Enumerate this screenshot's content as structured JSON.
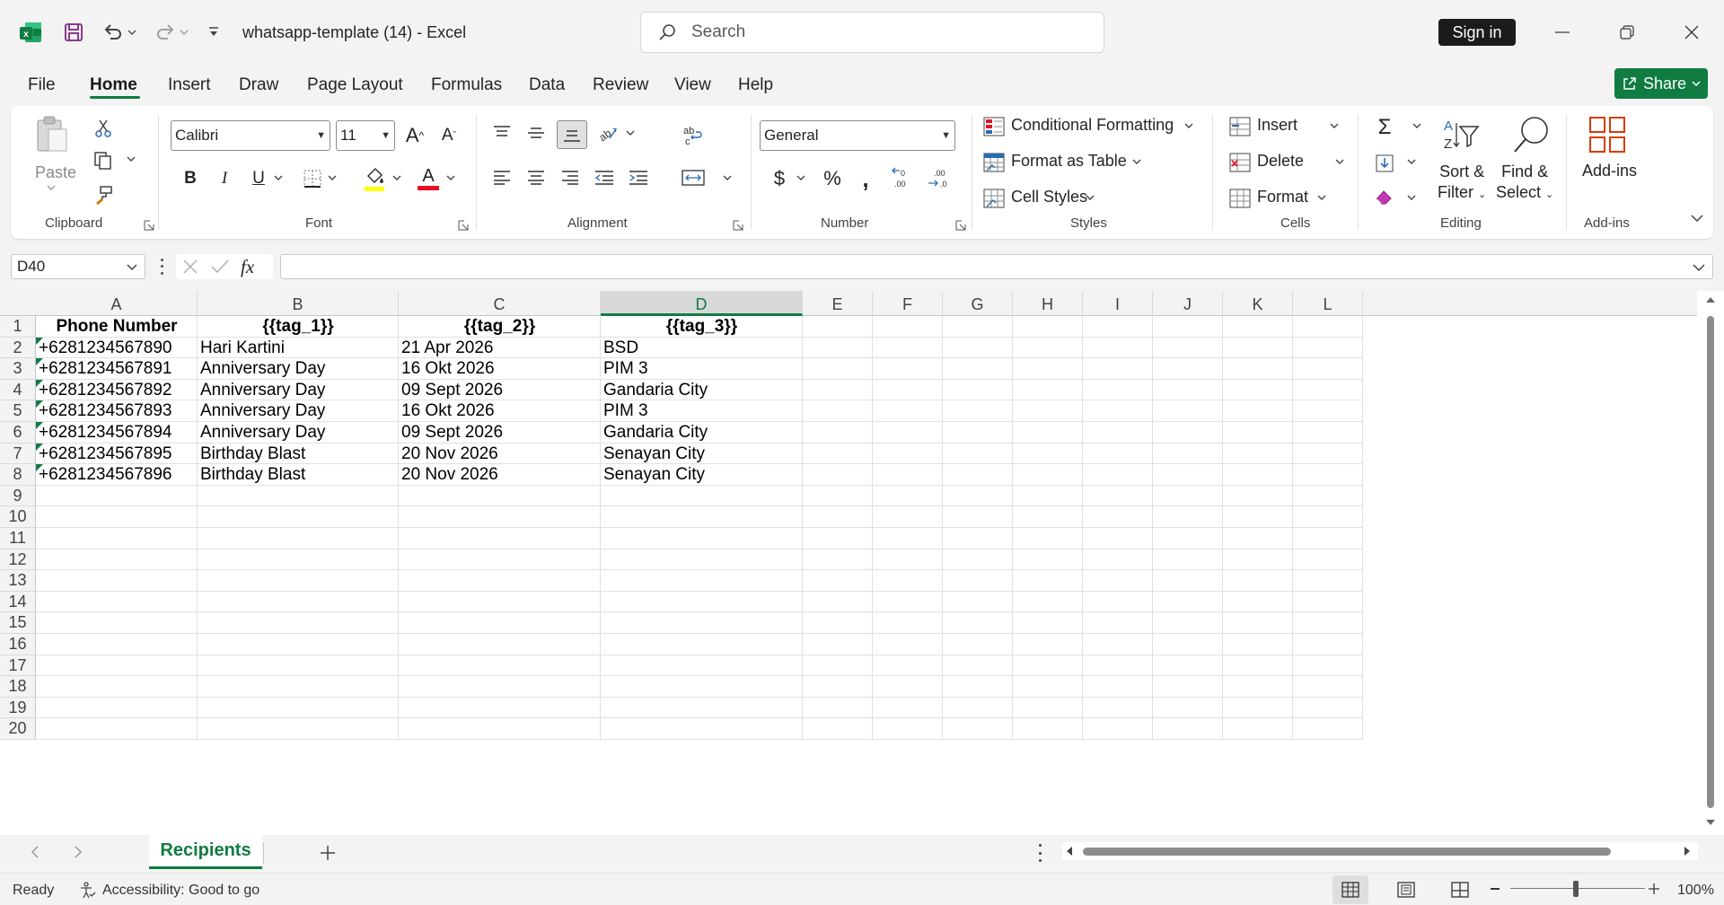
{
  "titlebar": {
    "doc_title": "whatsapp-template (14)  -  Excel",
    "search_placeholder": "Search",
    "signin_label": "Sign in"
  },
  "menu": {
    "tabs": [
      "File",
      "Home",
      "Insert",
      "Draw",
      "Page Layout",
      "Formulas",
      "Data",
      "Review",
      "View",
      "Help"
    ],
    "active": "Home",
    "share_label": "Share"
  },
  "ribbon": {
    "clipboard": {
      "label": "Clipboard",
      "paste": "Paste"
    },
    "font": {
      "label": "Font",
      "name": "Calibri",
      "size": "11"
    },
    "alignment": {
      "label": "Alignment"
    },
    "number": {
      "label": "Number",
      "format": "General"
    },
    "styles": {
      "label": "Styles",
      "conditional": "Conditional Formatting",
      "format_table": "Format as Table",
      "cell_styles": "Cell Styles"
    },
    "cells": {
      "label": "Cells",
      "insert": "Insert",
      "delete": "Delete",
      "format": "Format"
    },
    "editing": {
      "label": "Editing",
      "sort_line1": "Sort &",
      "sort_line2": "Filter",
      "find_line1": "Find &",
      "find_line2": "Select"
    },
    "addins": {
      "label": "Add-ins",
      "button": "Add-ins"
    }
  },
  "formula_bar": {
    "name_box": "D40",
    "formula": ""
  },
  "columns": [
    "A",
    "B",
    "C",
    "D",
    "E",
    "F",
    "G",
    "H",
    "I",
    "J",
    "K",
    "L"
  ],
  "selected_column": "D",
  "rows": [
    "1",
    "2",
    "3",
    "4",
    "5",
    "6",
    "7",
    "8",
    "9",
    "10",
    "11",
    "12",
    "13",
    "14",
    "15",
    "16",
    "17",
    "18",
    "19",
    "20"
  ],
  "sheet": {
    "headers": [
      "Phone Number",
      "{{tag_1}}",
      "{{tag_2}}",
      "{{tag_3}}"
    ],
    "data": [
      [
        "+6281234567890",
        "Hari Kartini",
        "21 Apr 2026",
        "BSD"
      ],
      [
        "+6281234567891",
        "Anniversary Day",
        "16 Okt 2026",
        "PIM 3"
      ],
      [
        "+6281234567892",
        "Anniversary Day",
        "09 Sept 2026",
        "Gandaria City"
      ],
      [
        "+6281234567893",
        "Anniversary Day",
        "16 Okt 2026",
        "PIM 3"
      ],
      [
        "+6281234567894",
        "Anniversary Day",
        "09 Sept 2026",
        "Gandaria City"
      ],
      [
        "+6281234567895",
        "Birthday Blast",
        "20 Nov 2026",
        "Senayan City"
      ],
      [
        "+6281234567896",
        "Birthday Blast",
        "20 Nov 2026",
        "Senayan City"
      ]
    ]
  },
  "sheet_tabs": {
    "active": "Recipients"
  },
  "status": {
    "ready": "Ready",
    "accessibility": "Accessibility: Good to go",
    "zoom": "100%"
  },
  "colors": {
    "accent": "#107c41",
    "font_color_bar": "#e81123",
    "highlight_bar": "#ffff00"
  }
}
